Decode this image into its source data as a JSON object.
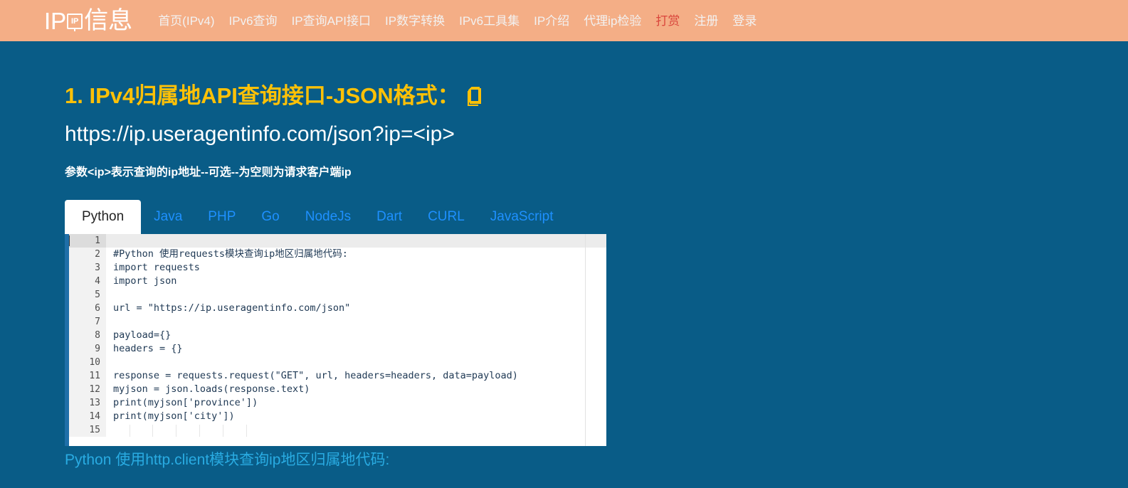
{
  "header": {
    "brand": {
      "prefix": "IP",
      "badge": "IP",
      "suffix": "信息"
    },
    "nav": [
      {
        "label": "首页(IPv4)",
        "accent": false
      },
      {
        "label": "IPv6查询",
        "accent": false
      },
      {
        "label": "IP查询API接口",
        "accent": false
      },
      {
        "label": "IP数字转换",
        "accent": false
      },
      {
        "label": "IPv6工具集",
        "accent": false
      },
      {
        "label": "IP介绍",
        "accent": false
      },
      {
        "label": "代理ip检验",
        "accent": false
      },
      {
        "label": "打赏",
        "accent": true
      },
      {
        "label": "注册",
        "accent": false
      },
      {
        "label": "登录",
        "accent": false
      }
    ]
  },
  "main": {
    "section_title": "1. IPv4归属地API查询接口-JSON格式：",
    "section_title_icon": "pages-icon",
    "api_url": "https://ip.useragentinfo.com/json?ip=<ip>",
    "param_note": "参数<ip>表示查询的ip地址--可选--为空则为请求客户端ip",
    "tabs": [
      {
        "label": "Python",
        "active": true
      },
      {
        "label": "Java",
        "active": false
      },
      {
        "label": "PHP",
        "active": false
      },
      {
        "label": "Go",
        "active": false
      },
      {
        "label": "NodeJs",
        "active": false
      },
      {
        "label": "Dart",
        "active": false
      },
      {
        "label": "CURL",
        "active": false
      },
      {
        "label": "JavaScript",
        "active": false
      }
    ],
    "code_lines": [
      {
        "n": "1",
        "text": ""
      },
      {
        "n": "2",
        "text": "#Python 使用requests模块查询ip地区归属地代码:"
      },
      {
        "n": "3",
        "text": "import requests"
      },
      {
        "n": "4",
        "text": "import json"
      },
      {
        "n": "5",
        "text": ""
      },
      {
        "n": "6",
        "text": "url = \"https://ip.useragentinfo.com/json\""
      },
      {
        "n": "7",
        "text": ""
      },
      {
        "n": "8",
        "text": "payload={}"
      },
      {
        "n": "9",
        "text": "headers = {}"
      },
      {
        "n": "10",
        "text": ""
      },
      {
        "n": "11",
        "text": "response = requests.request(\"GET\", url, headers=headers, data=payload)"
      },
      {
        "n": "12",
        "text": "myjson = json.loads(response.text)"
      },
      {
        "n": "13",
        "text": "print(myjson['province'])"
      },
      {
        "n": "14",
        "text": "print(myjson['city'])"
      },
      {
        "n": "15",
        "text": ""
      }
    ],
    "bottom_note": "Python 使用http.client模块查询ip地区归属地代码:"
  },
  "colors": {
    "header_bg": "#F4AE86",
    "page_bg": "#095C87",
    "title_gold": "#FFC107",
    "tab_blue": "#1E90FF",
    "accent_red": "#D9463C",
    "bottom_note_blue": "#29ABE2",
    "editor_bg": "#FFFFFF",
    "gutter_bg": "#F2F2F2"
  }
}
